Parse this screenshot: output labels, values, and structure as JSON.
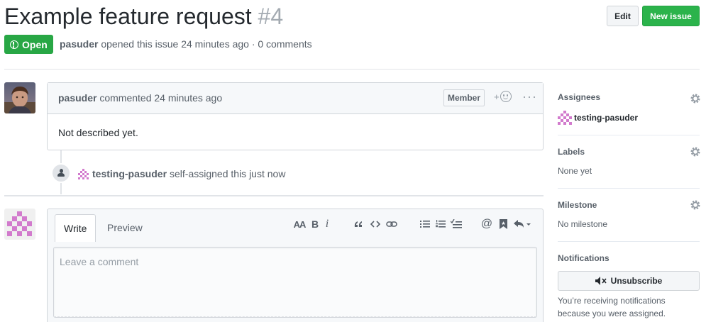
{
  "issue": {
    "title": "Example feature request",
    "number": "#4",
    "state": "Open",
    "author": "pasuder",
    "opened_text": "opened this issue 24 minutes ago · 0 comments"
  },
  "header_buttons": {
    "edit": "Edit",
    "new_issue": "New issue"
  },
  "comment": {
    "author": "pasuder",
    "action": "commented 24 minutes ago",
    "role_badge": "Member",
    "reaction_plus": "+",
    "body": "Not described yet."
  },
  "event": {
    "actor": "testing-pasuder",
    "action": "self-assigned this just now"
  },
  "editor": {
    "tab_write": "Write",
    "tab_preview": "Preview",
    "placeholder": "Leave a comment",
    "toolbar": {
      "header": "AA",
      "bold": "B",
      "italic": "i",
      "mention": "@"
    }
  },
  "sidebar": {
    "assignees": {
      "heading": "Assignees",
      "value": "testing-pasuder"
    },
    "labels": {
      "heading": "Labels",
      "value": "None yet"
    },
    "milestone": {
      "heading": "Milestone",
      "value": "No milestone"
    },
    "notifications": {
      "heading": "Notifications",
      "button": "Unsubscribe",
      "reason_line1": "You’re receiving notifications",
      "reason_line2": "because you were assigned."
    }
  },
  "colors": {
    "open_green": "#28a745",
    "new_issue_green": "#2bb34b",
    "identicon_pink": "#d27bcd"
  },
  "icons": [
    "alert-icon",
    "smiley-icon",
    "kebab-icon",
    "person-icon",
    "gear-icon",
    "mute-icon",
    "quote-icon",
    "code-icon",
    "link-icon",
    "list-unordered-icon",
    "list-ordered-icon",
    "tasklist-icon",
    "bookmark-icon",
    "reply-icon"
  ]
}
